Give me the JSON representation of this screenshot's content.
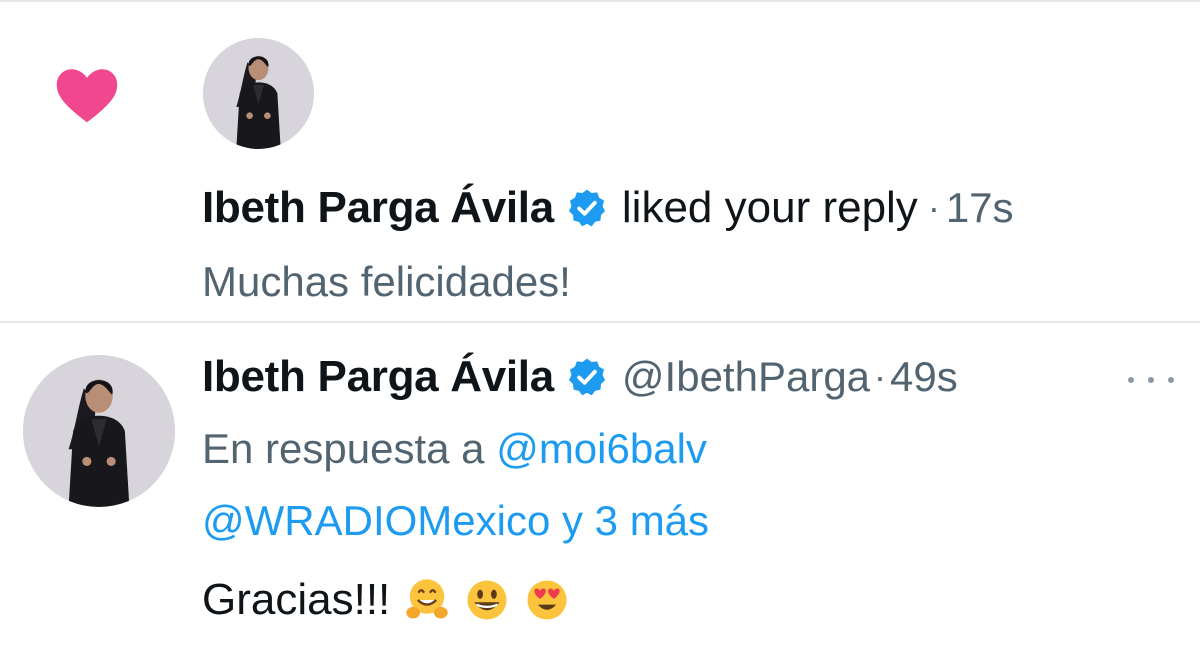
{
  "notification": {
    "type_icon": "heart-icon",
    "actor_name": "Ibeth Parga Ávila",
    "action": "liked your reply",
    "separator": "·",
    "time": "17s",
    "preview": "Muchas felicidades!"
  },
  "reply": {
    "author_name": "Ibeth Parga Ávila",
    "handle": "@IbethParga",
    "separator": "·",
    "time": "49s",
    "in_reply_prefix": "En respuesta a",
    "reply_mention_1": "@moi6balv",
    "reply_mention_2": "@WRADIOMexico y 3 más",
    "text": "Gracias!!!",
    "emojis": [
      "hugging-face-emoji",
      "grinning-face-emoji",
      "heart-eyes-emoji"
    ]
  },
  "colors": {
    "heart": "#f91880",
    "verified": "#1d9bf0",
    "link": "#1d9bf0",
    "muted": "#536471"
  }
}
